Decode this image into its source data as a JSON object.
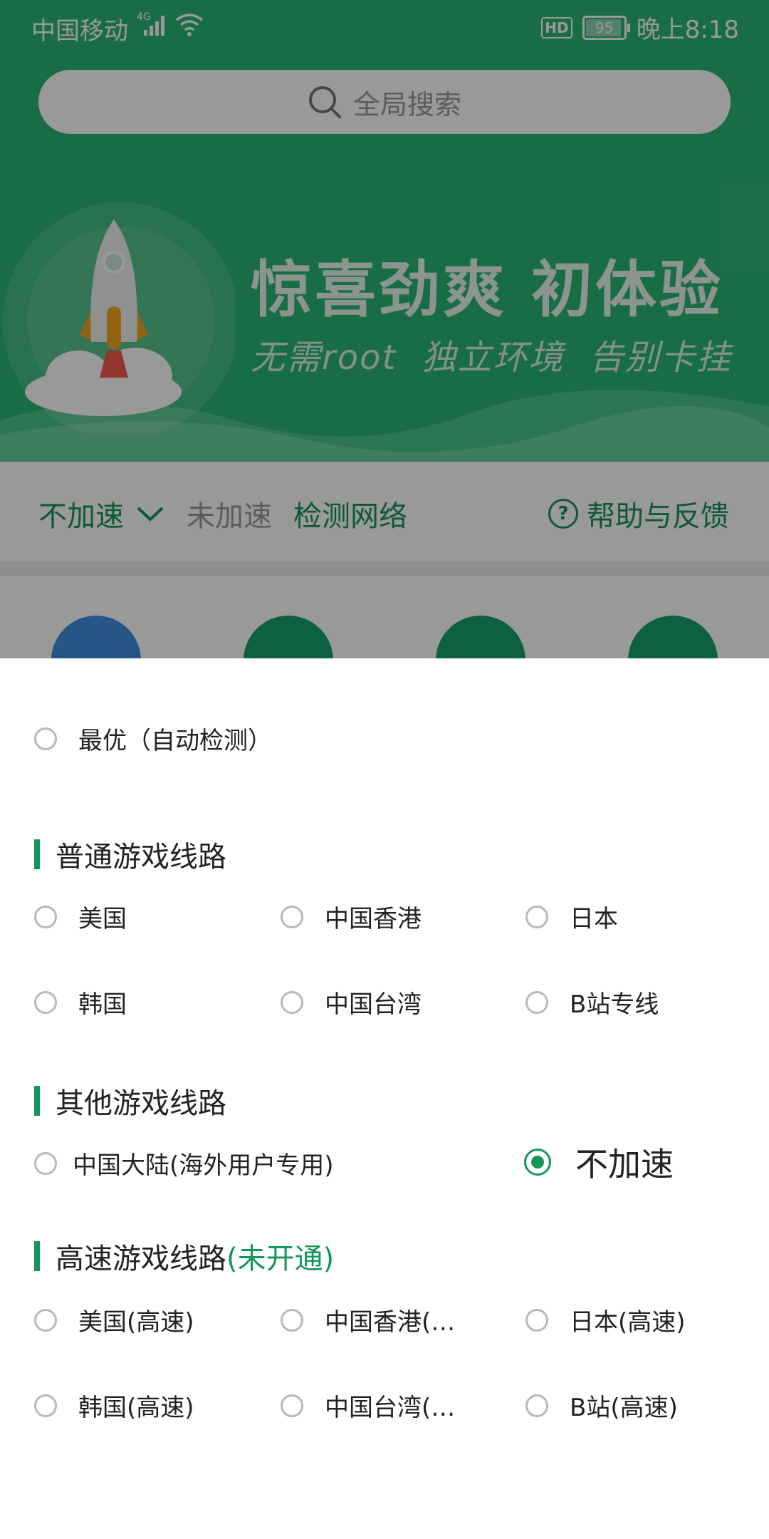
{
  "status_bar": {
    "carrier": "中国移动",
    "network": "4G",
    "hd": "HD",
    "battery": "95",
    "battery_level": 0.95,
    "time": "晚上8:18"
  },
  "search": {
    "placeholder": "全局搜索"
  },
  "banner": {
    "title": "惊喜劲爽  初体验",
    "subtitle": "无需root  独立环境  告别卡挂"
  },
  "toolbar": {
    "mode_label": "不加速",
    "state_label": "未加速",
    "detect_label": "检测网络",
    "help_label": "帮助与反馈"
  },
  "colors": {
    "accent": "#16955a",
    "hero": "#2bb673",
    "radio_off": "#b9b9b9"
  },
  "sheet": {
    "auto_option": "最优（自动检测）",
    "normal_section": "普通游戏线路",
    "normal_options": [
      "美国",
      "中国香港",
      "日本",
      "韩国",
      "中国台湾",
      "B站专线"
    ],
    "other_section": "其他游戏线路",
    "other_options": [
      "中国大陆(海外用户专用)",
      "不加速"
    ],
    "selected_option": "不加速",
    "fast_section": "高速游戏线路",
    "fast_section_tag": "(未开通)",
    "fast_options": [
      "美国(高速)",
      "中国香港(高速)",
      "日本(高速)",
      "韩国(高速)",
      "中国台湾(高速)",
      "B站(高速)"
    ]
  }
}
